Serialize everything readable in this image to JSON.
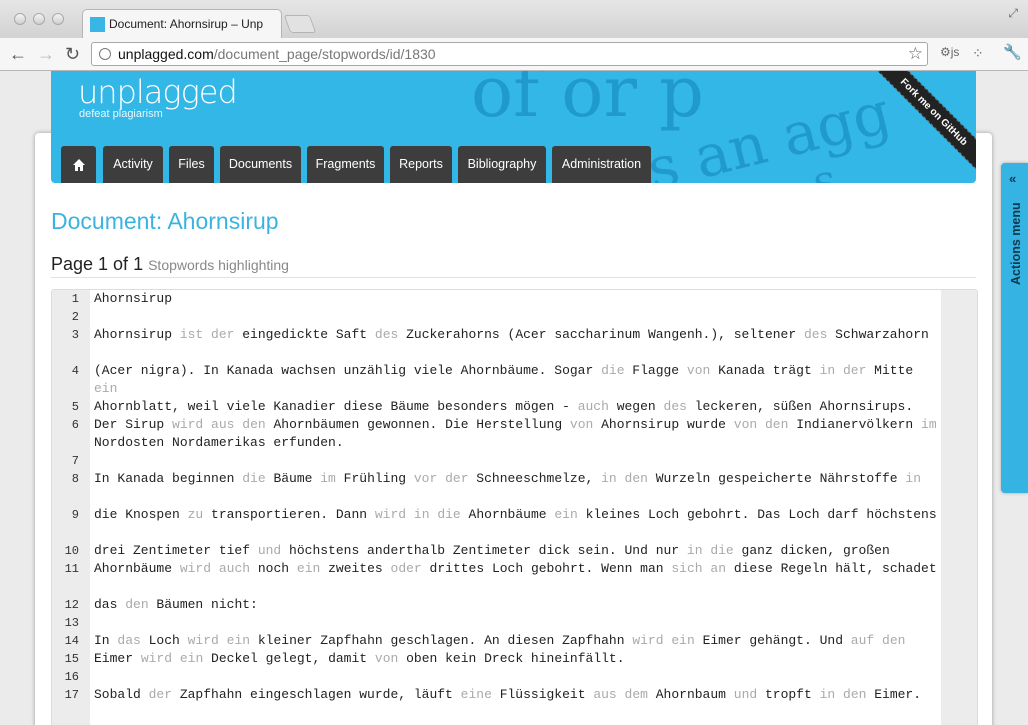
{
  "browser": {
    "tab_title": "Document: Ahornsirup – Unp",
    "url_host": "unplagged.com",
    "url_path": "/document_page/stopwords/id/1830",
    "ext_label": "js"
  },
  "brand": {
    "logo": "unplagged",
    "tagline": "defeat plagiarism",
    "ribbon": "Fork me on GitHub",
    "accent": "#32b7e6"
  },
  "nav": {
    "items": [
      "Activity",
      "Files",
      "Documents",
      "Fragments",
      "Reports",
      "Bibliography",
      "Administration"
    ]
  },
  "document": {
    "title": "Document: Ahornsirup",
    "page_label": "Page 1 of 1",
    "mode_label": "Stopwords highlighting"
  },
  "lines": [
    {
      "n": "1",
      "text": "Ahornsirup"
    },
    {
      "n": "2",
      "text": ""
    },
    {
      "n": "3",
      "text": "Ahornsirup [ist] [der] eingedickte Saft [des] Zuckerahorns (Acer saccharinum Wangenh.), seltener [des] Schwarzahorn"
    },
    {
      "n": "4",
      "text": "(Acer nigra). In Kanada wachsen unzählig viele Ahornbäume. Sogar [die] Flagge [von] Kanada trägt [in] [der] Mitte [ein]"
    },
    {
      "n": "5",
      "text": "Ahornblatt, weil viele Kanadier diese Bäume besonders mögen - [auch] wegen [des] leckeren, süßen Ahornsirups."
    },
    {
      "n": "6",
      "text": "Der Sirup [wird] [aus] [den] Ahornbäumen gewonnen. Die Herstellung [von] Ahornsirup wurde [von] [den] Indianervölkern [im] Nordosten Nordamerikas erfunden."
    },
    {
      "n": "7",
      "text": ""
    },
    {
      "n": "8",
      "text": "In Kanada beginnen [die] Bäume [im] Frühling [vor] [der] Schneeschmelze, [in] [den] Wurzeln gespeicherte Nährstoffe [in]"
    },
    {
      "n": "9",
      "text": "die Knospen [zu] transportieren. Dann [wird] [in] [die] Ahornbäume [ein] kleines Loch gebohrt. Das Loch darf höchstens"
    },
    {
      "n": "10",
      "text": "drei Zentimeter tief [und] höchstens anderthalb Zentimeter dick sein. Und nur [in] [die] ganz dicken, großen"
    },
    {
      "n": "11",
      "text": "Ahornbäume [wird] [auch] noch [ein] zweites [oder] drittes Loch gebohrt. Wenn man [sich] [an] diese Regeln hält, schadet"
    },
    {
      "n": "12",
      "text": "das [den] Bäumen nicht:"
    },
    {
      "n": "13",
      "text": ""
    },
    {
      "n": "14",
      "text": "In [das] Loch [wird] [ein] kleiner Zapfhahn geschlagen. An diesen Zapfhahn [wird] [ein] Eimer gehängt. Und [auf] [den]"
    },
    {
      "n": "15",
      "text": "Eimer [wird] [ein] Deckel gelegt, damit [von] oben kein Dreck hineinfällt."
    },
    {
      "n": "16",
      "text": ""
    },
    {
      "n": "17",
      "text": "Sobald [der] Zapfhahn eingeschlagen wurde, läuft [eine] Flüssigkeit [aus] [dem] Ahornbaum [und] tropft [in] [den] Eimer."
    }
  ],
  "actions_menu": {
    "label": "Actions menu",
    "chevron": "«"
  }
}
